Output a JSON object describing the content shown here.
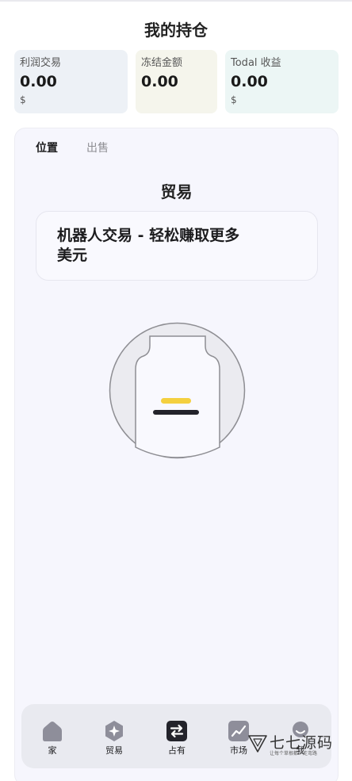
{
  "header": {
    "title": "我的持仓"
  },
  "stats": [
    {
      "label": "利润交易",
      "value": "0.00",
      "currency": "$"
    },
    {
      "label": "冻结金额",
      "value": "0.00",
      "currency": ""
    },
    {
      "label": "Todal 收益",
      "value": "0.00",
      "currency": "$"
    }
  ],
  "tabs": [
    {
      "label": "位置",
      "active": true
    },
    {
      "label": "出售",
      "active": false
    }
  ],
  "section": {
    "title": "贸易",
    "banner": "机器人交易 - 轻松赚取更多美元"
  },
  "empty_state": {
    "icon": "empty-document-icon"
  },
  "nav": [
    {
      "label": "家",
      "icon": "home-icon"
    },
    {
      "label": "贸易",
      "icon": "trade-icon"
    },
    {
      "label": "占有",
      "icon": "exchange-icon",
      "active": true
    },
    {
      "label": "市场",
      "icon": "market-chart-icon"
    },
    {
      "label": "我",
      "icon": "user-icon"
    }
  ],
  "watermark": {
    "title": "七七源码",
    "subtitle": "让每个草根都少走弯路"
  },
  "colors": {
    "accent_yellow": "#f4d03f",
    "dark": "#23232b",
    "panel_bg": "#f6f6fd",
    "nav_bg": "#e9eaf0"
  }
}
